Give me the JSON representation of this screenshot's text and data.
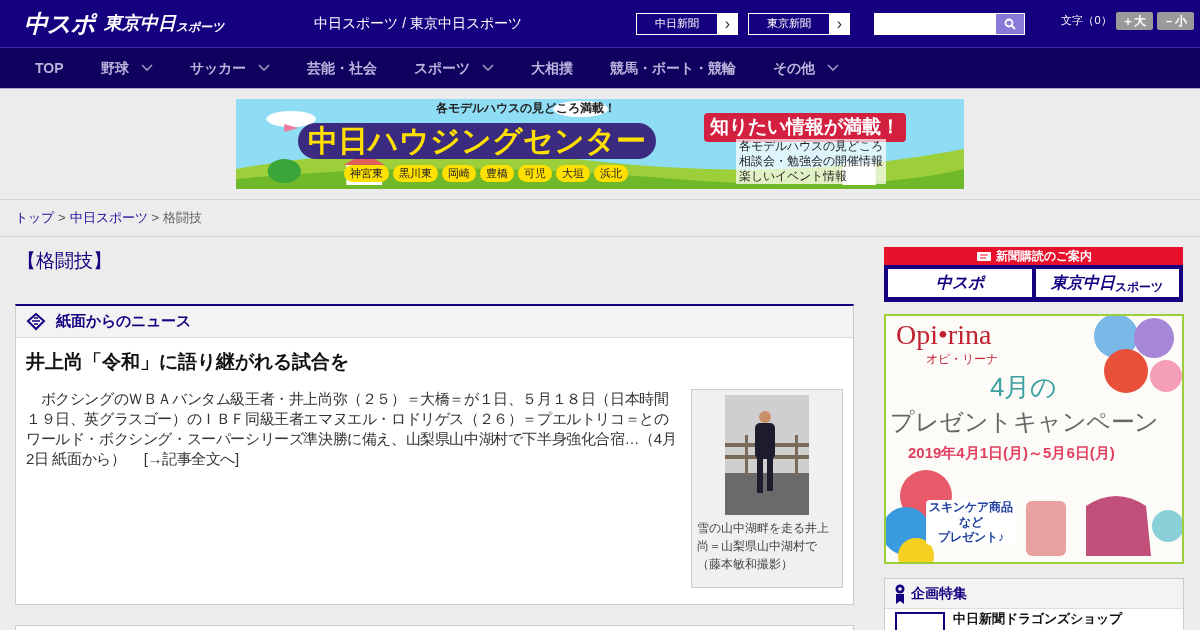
{
  "header": {
    "logo": "中スポ",
    "logo2": "東京中日",
    "logo2_sub": "スポーツ",
    "site_title": "中日スポーツ / 東京中日スポーツ",
    "paper_links": [
      {
        "label": "中日新聞",
        "arrow": "›"
      },
      {
        "label": "東京新聞",
        "arrow": "›"
      }
    ],
    "font_size": {
      "label": "文字（0）",
      "buttons": [
        "＋大",
        "－小"
      ]
    }
  },
  "nav": [
    {
      "label": "TOP",
      "dropdown": false
    },
    {
      "label": "野球",
      "dropdown": true
    },
    {
      "label": "サッカー",
      "dropdown": true
    },
    {
      "label": "芸能・社会",
      "dropdown": false
    },
    {
      "label": "スポーツ",
      "dropdown": true
    },
    {
      "label": "大相撲",
      "dropdown": false
    },
    {
      "label": "競馬・ボート・競輪",
      "dropdown": false
    },
    {
      "label": "その他",
      "dropdown": true
    }
  ],
  "ad_banner": {
    "kind": "picture",
    "tagline": "各モデルハウスの見どころ満載！",
    "title": "中日ハウジングセンター",
    "places": [
      "神宮東",
      "黒川東",
      "岡崎",
      "豊橋",
      "可児",
      "大垣",
      "浜北"
    ],
    "headline": "知りたい情報が満載！",
    "points": [
      "各モデルハウスの見どころ",
      "相談会・勉強会の開催情報",
      "楽しいイベント情報"
    ]
  },
  "breadcrumb": [
    {
      "label": "トップ",
      "link": true
    },
    {
      "label": "中日スポーツ",
      "link": true
    },
    {
      "label": "格闘技",
      "link": false
    }
  ],
  "breadcrumb_sep": ">",
  "page_title": "【格闘技】",
  "news_box": {
    "heading": "紙面からのニュース",
    "article": {
      "title": "井上尚「令和」に語り継がれる試合を",
      "body": "　ボクシングのＷＢＡバンタム級王者・井上尚弥（２５）＝大橋＝が１日、５月１８日（日本時間１９日、英グラスゴー）のＩＢＦ同級王者エマヌエル・ロドリゲス（２６）＝プエルトリコ＝とのワールド・ボクシング・スーパーシリーズ準決勝に備え、山梨県山中湖村で下半身強化合宿…（4月2日 紙面から）",
      "more_link": "[→記事全文へ]",
      "photo": {
        "kind": "picture",
        "caption": "雪の山中湖畔を走る井上尚＝山梨県山中湖村で（藤本敏和撮影）"
      }
    }
  },
  "subscription": {
    "title": "新聞購読のご案内",
    "buttons": [
      "中スポ",
      "東京中日"
    ],
    "button2_sub": "スポーツ"
  },
  "side_ad": {
    "kind": "picture",
    "brand": "Opi•rina",
    "brand_sub": "オピ・リーナ",
    "month": "4月の",
    "title": "プレゼントキャンペーン",
    "dates": "2019年4月1日(月)～5月6日(月)",
    "note_lines": [
      "スキンケア商品",
      "など",
      "プレゼント♪"
    ]
  },
  "features": {
    "heading": "企画特集",
    "items": [
      "中日新聞ドラゴンズショップ"
    ]
  }
}
